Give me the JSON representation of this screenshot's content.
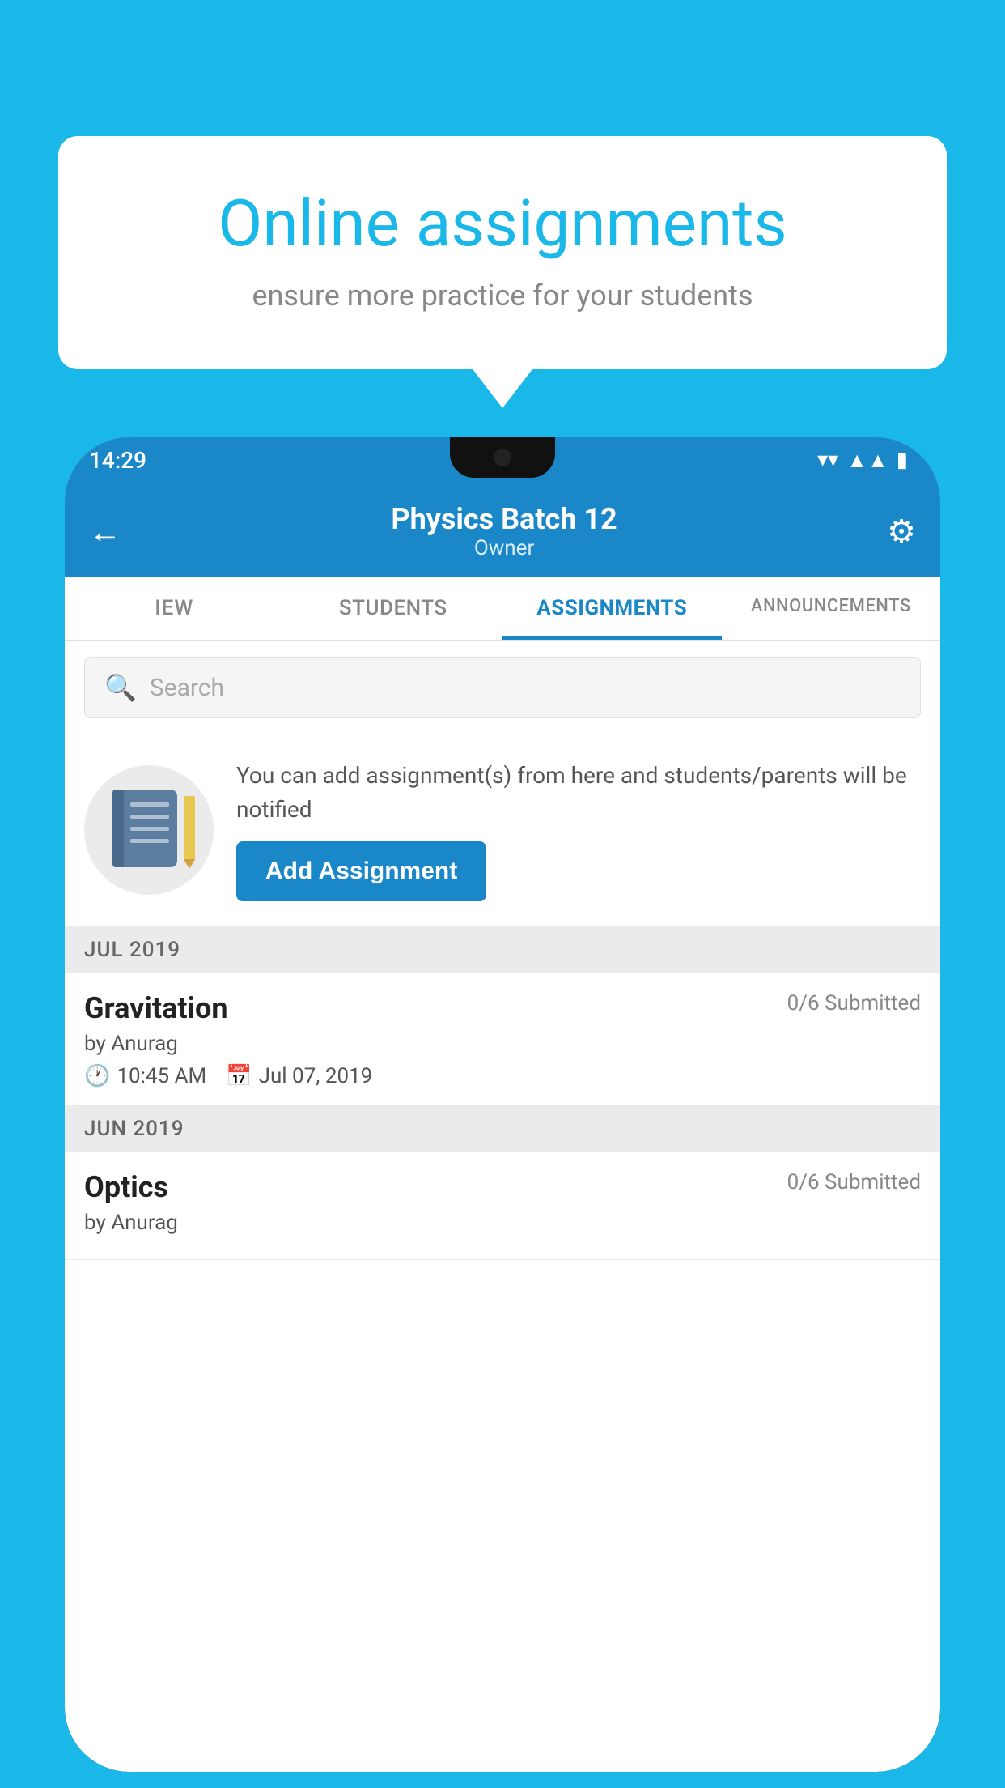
{
  "background": {
    "color": "#1ab8e8"
  },
  "speech_bubble": {
    "title": "Online assignments",
    "subtitle": "ensure more practice for your students"
  },
  "status_bar": {
    "time": "14:29",
    "wifi": "▲",
    "signal": "◀",
    "battery": "▮"
  },
  "header": {
    "title": "Physics Batch 12",
    "subtitle": "Owner",
    "back_label": "←",
    "gear_label": "⚙"
  },
  "tabs": [
    {
      "label": "IEW",
      "active": false
    },
    {
      "label": "STUDENTS",
      "active": false
    },
    {
      "label": "ASSIGNMENTS",
      "active": true
    },
    {
      "label": "ANNOUNCEMENTS",
      "active": false
    }
  ],
  "search": {
    "placeholder": "Search"
  },
  "add_section": {
    "description": "You can add assignment(s) from here and students/parents will be notified",
    "button_label": "Add Assignment"
  },
  "month_groups": [
    {
      "label": "JUL 2019",
      "assignments": [
        {
          "name": "Gravitation",
          "submitted": "0/6 Submitted",
          "by": "by Anurag",
          "time": "10:45 AM",
          "date": "Jul 07, 2019"
        }
      ]
    },
    {
      "label": "JUN 2019",
      "assignments": [
        {
          "name": "Optics",
          "submitted": "0/6 Submitted",
          "by": "by Anurag",
          "time": "",
          "date": ""
        }
      ]
    }
  ]
}
